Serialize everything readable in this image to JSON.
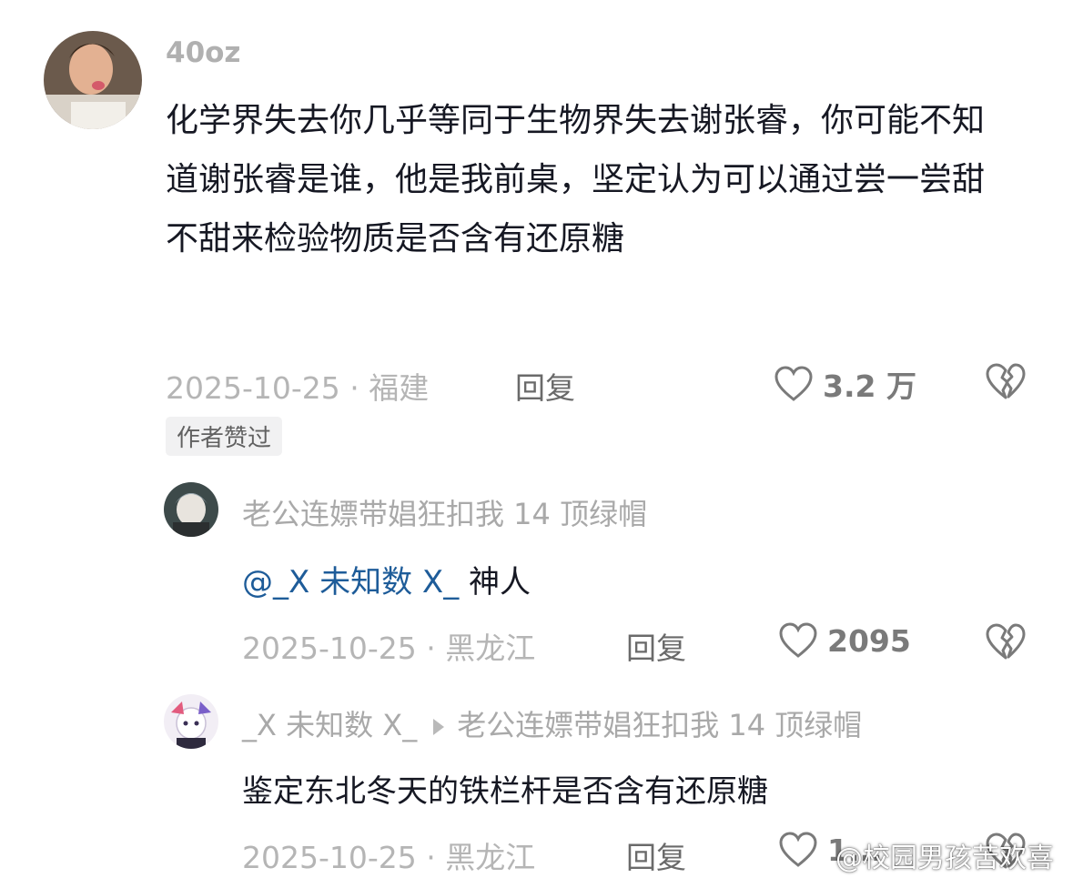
{
  "comment": {
    "username": "40oz",
    "text": "化学界失去你几乎等同于生物界失去谢张睿，你可能不知道谢张睿是谁，他是我前桌，坚定认为可以通过尝一尝甜不甜来检验物质是否含有还原糖",
    "meta": "2025-10-25 · 福建",
    "reply_label": "回复",
    "likes": "3.2 万",
    "badge": "作者赞过"
  },
  "replies": [
    {
      "username": "老公连嫖带娼狂扣我 14 顶绿帽",
      "mention": "@_X 未知数 X_",
      "text": " 神人",
      "meta": "2025-10-25 · 黑龙江",
      "reply_label": "回复",
      "likes": "2095"
    },
    {
      "username": "_X 未知数 X_",
      "reply_to": "老公连嫖带娼狂扣我 14 顶绿帽",
      "text": "鉴定东北冬天的铁栏杆是否含有还原糖",
      "meta": "2025-10-25 · 黑龙江",
      "reply_label": "回复",
      "likes": "1..."
    }
  ],
  "watermark": "@校园男孩苦欢喜",
  "colors": {
    "text": "#161823",
    "muted": "#a9a9a9",
    "mention": "#1e5c99",
    "icon": "#7a7a7a"
  },
  "icons": [
    "heart-icon",
    "broken-heart-icon",
    "arrow-icon"
  ]
}
